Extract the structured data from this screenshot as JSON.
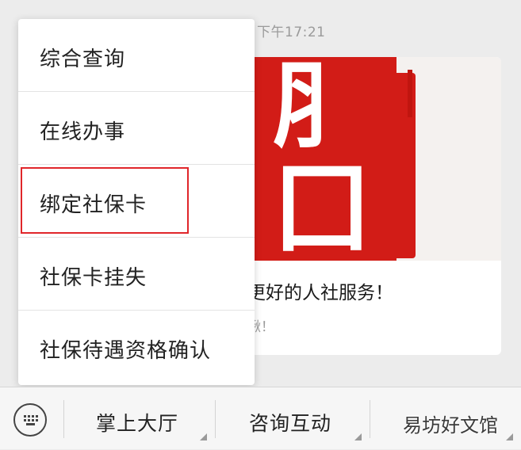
{
  "chat": {
    "timestamp": "下午17:21",
    "article": {
      "title": "更好的人社服务！",
      "subtitle": "啾！"
    }
  },
  "popup_menu": {
    "items": [
      {
        "label": "综合查询"
      },
      {
        "label": "在线办事"
      },
      {
        "label": "绑定社保卡"
      },
      {
        "label": "社保卡挂失"
      },
      {
        "label": "社保待遇资格确认"
      }
    ],
    "highlighted_index": 2
  },
  "bottom_bar": {
    "tabs": [
      {
        "label": "掌上大厅"
      },
      {
        "label": "咨询互动"
      },
      {
        "label": "易坊好文馆"
      }
    ]
  },
  "colors": {
    "highlight_border": "#e0262a",
    "seal_red": "#d21c17"
  }
}
